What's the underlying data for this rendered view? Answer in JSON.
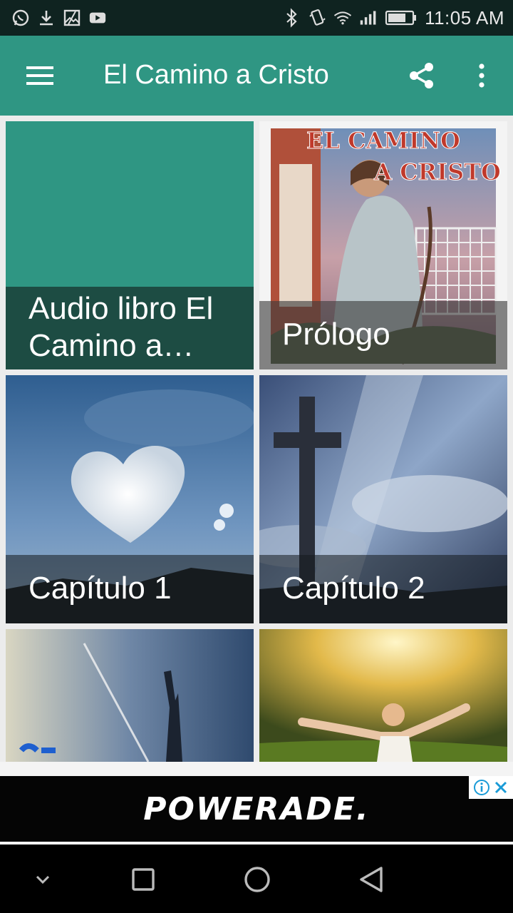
{
  "status_bar": {
    "time": "11:05 AM",
    "left_icons": [
      "whatsapp-icon",
      "download-icon",
      "image-icon",
      "youtube-icon"
    ],
    "right_icons": [
      "bluetooth-icon",
      "vibrate-icon",
      "wifi-icon",
      "signal-icon",
      "battery-icon"
    ]
  },
  "app_bar": {
    "title": "El Camino a Cristo",
    "background": "#2f9683"
  },
  "tiles": [
    {
      "caption": "Audio libro El Camino a Cristo"
    },
    {
      "caption": "Prólogo",
      "cover_line1": "EL CAMINO",
      "cover_line2": "A CRISTO"
    },
    {
      "caption": "Capítulo 1"
    },
    {
      "caption": "Capítulo 2"
    },
    {
      "caption": ""
    },
    {
      "caption": ""
    }
  ],
  "ad": {
    "brand": "POWERADE."
  }
}
